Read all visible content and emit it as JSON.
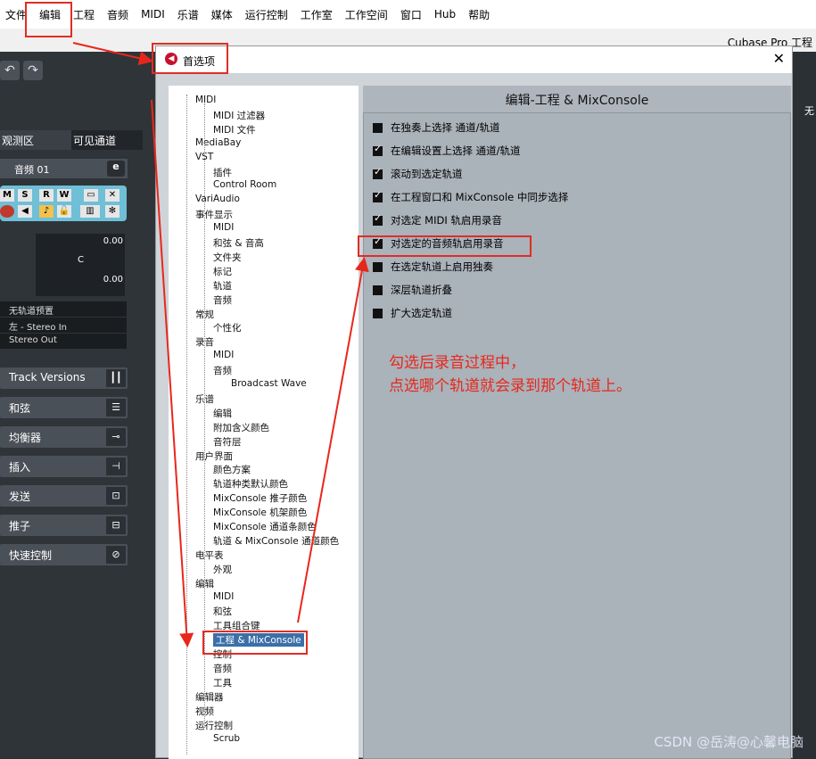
{
  "menubar": {
    "items": [
      "文件",
      "编辑",
      "工程",
      "音频",
      "MIDI",
      "乐谱",
      "媒体",
      "运行控制",
      "工作室",
      "工作空间",
      "窗口",
      "Hub",
      "帮助"
    ],
    "app_title": "Cubase Pro 工程"
  },
  "cubase": {
    "undo_icon": "undo-icon",
    "redo_icon": "redo-icon",
    "tabs": [
      "观测区",
      "可见通道"
    ],
    "track_name": "音频 01",
    "fader_values": [
      "0.00",
      "C",
      "0.00"
    ],
    "routing": [
      "无轨道预置",
      "左 - Stereo In",
      "Stereo Out"
    ],
    "sections": [
      "Track Versions",
      "和弦",
      "均衡器",
      "插入",
      "发送",
      "推子",
      "快速控制"
    ],
    "right_text": "无"
  },
  "dialog": {
    "title": "首选项",
    "close": "✕",
    "panel_title": "编辑-工程 & MixConsole"
  },
  "tree": [
    {
      "label": "MIDI",
      "level": 0
    },
    {
      "label": "MIDI 过滤器",
      "level": 1
    },
    {
      "label": "MIDI 文件",
      "level": 1
    },
    {
      "label": "MediaBay",
      "level": 0
    },
    {
      "label": "VST",
      "level": 0
    },
    {
      "label": "插件",
      "level": 1
    },
    {
      "label": "Control Room",
      "level": 1
    },
    {
      "label": "VariAudio",
      "level": 0
    },
    {
      "label": "事件显示",
      "level": 0
    },
    {
      "label": "MIDI",
      "level": 1
    },
    {
      "label": "和弦 & 音高",
      "level": 1
    },
    {
      "label": "文件夹",
      "level": 1
    },
    {
      "label": "标记",
      "level": 1
    },
    {
      "label": "轨道",
      "level": 1
    },
    {
      "label": "音频",
      "level": 1
    },
    {
      "label": "常规",
      "level": 0
    },
    {
      "label": "个性化",
      "level": 1
    },
    {
      "label": "录音",
      "level": 0
    },
    {
      "label": "MIDI",
      "level": 1
    },
    {
      "label": "音频",
      "level": 1
    },
    {
      "label": "Broadcast Wave",
      "level": 2
    },
    {
      "label": "乐谱",
      "level": 0
    },
    {
      "label": "编辑",
      "level": 1
    },
    {
      "label": "附加含义颜色",
      "level": 1
    },
    {
      "label": "音符层",
      "level": 1
    },
    {
      "label": "用户界面",
      "level": 0
    },
    {
      "label": "颜色方案",
      "level": 1
    },
    {
      "label": "轨道种类默认颜色",
      "level": 1
    },
    {
      "label": "MixConsole 推子颜色",
      "level": 1
    },
    {
      "label": "MixConsole 机架颜色",
      "level": 1
    },
    {
      "label": "MixConsole 通道条颜色",
      "level": 1
    },
    {
      "label": "轨道 & MixConsole 通道颜色",
      "level": 1
    },
    {
      "label": "电平表",
      "level": 0
    },
    {
      "label": "外观",
      "level": 1
    },
    {
      "label": "编辑",
      "level": 0
    },
    {
      "label": "MIDI",
      "level": 1
    },
    {
      "label": "和弦",
      "level": 1
    },
    {
      "label": "工具组合键",
      "level": 1
    },
    {
      "label": "工程 & MixConsole",
      "level": 1,
      "selected": true
    },
    {
      "label": "控制",
      "level": 1
    },
    {
      "label": "音频",
      "level": 1
    },
    {
      "label": "工具",
      "level": 1
    },
    {
      "label": "编辑器",
      "level": 0
    },
    {
      "label": "视频",
      "level": 0
    },
    {
      "label": "运行控制",
      "level": 0
    },
    {
      "label": "Scrub",
      "level": 1
    }
  ],
  "options": [
    {
      "label": "在独奏上选择 通道/轨道",
      "checked": false
    },
    {
      "label": "在编辑设置上选择 通道/轨道",
      "checked": true
    },
    {
      "label": "滚动到选定轨道",
      "checked": true
    },
    {
      "label": "在工程窗口和 MixConsole 中同步选择",
      "checked": true
    },
    {
      "label": "对选定 MIDI 轨启用录音",
      "checked": true
    },
    {
      "label": "对选定的音频轨启用录音",
      "checked": true
    },
    {
      "label": "在选定轨道上启用独奏",
      "checked": false
    },
    {
      "label": "深层轨道折叠",
      "checked": false
    },
    {
      "label": "扩大选定轨道",
      "checked": false
    }
  ],
  "annotation": {
    "line1": "勾选后录音过程中，",
    "line2": "点选哪个轨道就会录到那个轨道上。"
  },
  "watermark": "CSDN @岳涛@心馨电脑",
  "colors": {
    "annotation": "#e8271c",
    "selection": "#3b6fa8"
  }
}
